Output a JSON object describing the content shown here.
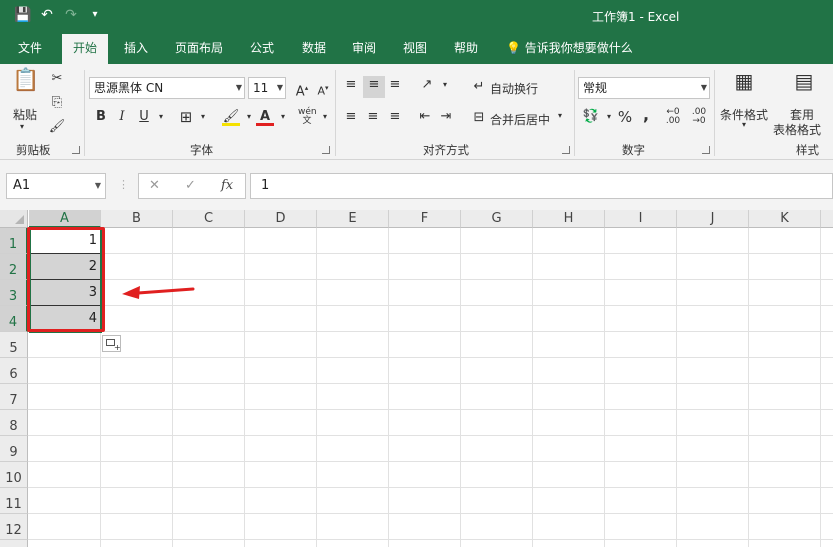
{
  "window": {
    "title": "工作簿1  -  Excel"
  },
  "qat": {
    "save": "💾",
    "undo": "↶",
    "redo": "↷",
    "customize": "▾"
  },
  "tabs": [
    "文件",
    "开始",
    "插入",
    "页面布局",
    "公式",
    "数据",
    "审阅",
    "视图",
    "帮助",
    "告诉我你想要做什么"
  ],
  "ribbon": {
    "clipboard": {
      "paste_label": "粘贴",
      "group": "剪贴板"
    },
    "font": {
      "font_name": "思源黑体 CN",
      "font_size": "11",
      "bold": "B",
      "italic": "I",
      "underline": "U",
      "wen": "wén",
      "group": "字体"
    },
    "align": {
      "wrap_text": "自动换行",
      "merge_center": "合并后居中",
      "group": "对齐方式"
    },
    "number": {
      "format": "常规",
      "percent": "%",
      "comma": ",",
      "group": "数字"
    },
    "styles": {
      "cond_format": "条件格式",
      "table_format_1": "套用",
      "table_format_2": "表格格式",
      "group": "样式"
    }
  },
  "formula": {
    "name_box": "A1",
    "cancel": "✕",
    "enter": "✓",
    "fx": "fx",
    "value": "1"
  },
  "grid": {
    "columns": [
      "A",
      "B",
      "C",
      "D",
      "E",
      "F",
      "G",
      "H",
      "I",
      "J",
      "K"
    ],
    "rows": [
      "1",
      "2",
      "3",
      "4",
      "5",
      "6",
      "7",
      "8",
      "9",
      "10",
      "11",
      "12"
    ],
    "cells": {
      "A1": "1",
      "A2": "2",
      "A3": "3",
      "A4": "4"
    }
  },
  "colors": {
    "accent": "#217346",
    "annotation": "#e02020",
    "selection_fill": "#d4d4d4"
  }
}
